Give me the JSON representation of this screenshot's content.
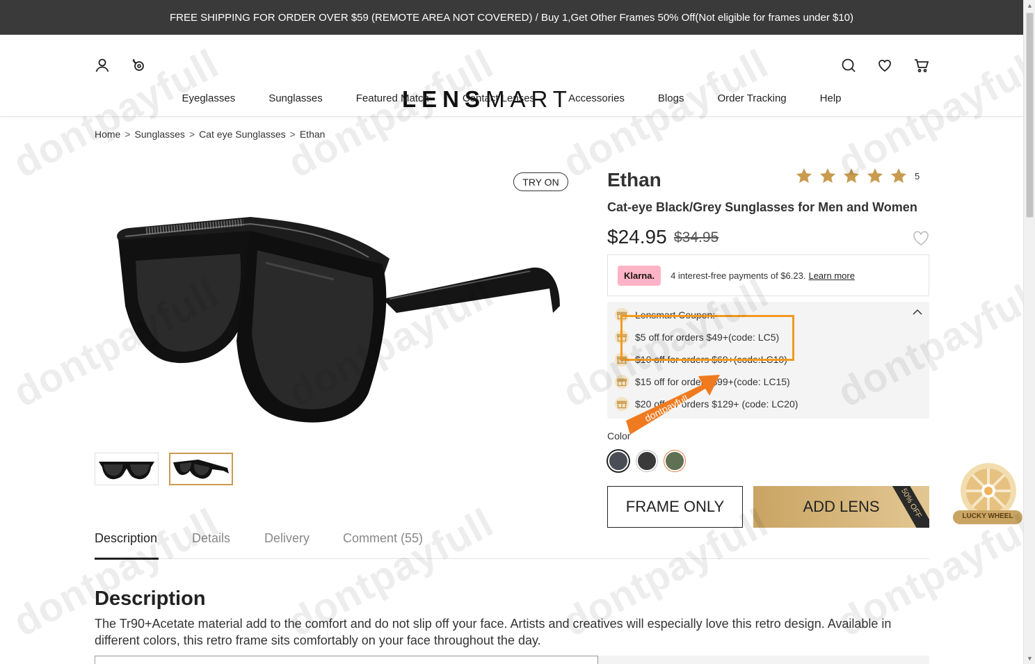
{
  "topbar": {
    "text": "FREE SHIPPING FOR ORDER OVER $59 (REMOTE AREA NOT COVERED) / Buy 1,Get Other Frames 50% Off(Not eligible for frames under $10)"
  },
  "header": {
    "logo_bold": "LENS",
    "logo_light": "MART",
    "icons": [
      "user-icon",
      "lens-icon",
      "search-icon",
      "heart-icon",
      "cart-icon"
    ]
  },
  "nav": [
    "Eyeglasses",
    "Sunglasses",
    "Featured Match",
    "Contact Lenses",
    "Accessories",
    "Blogs",
    "Order Tracking",
    "Help"
  ],
  "breadcrumb": {
    "items": [
      "Home",
      "Sunglasses",
      "Cat eye Sunglasses",
      "Ethan"
    ],
    "separator": ">"
  },
  "gallery": {
    "try_on": "TRY ON",
    "selected_thumb": 1
  },
  "product": {
    "name": "Ethan",
    "rating_count": "5",
    "subtitle": "Cat-eye Black/Grey Sunglasses for Men and Women",
    "price": "$24.95",
    "old_price": "$34.95",
    "rating_value": 5,
    "rating_max": 5,
    "star_color": "#c89b4f"
  },
  "klarna": {
    "badge": "Klarna.",
    "text": "4 interest-free payments of $6.23.",
    "link": "Learn more"
  },
  "coupons": {
    "title": "Lensmart Coupon:",
    "items": [
      "$5 off for orders $49+(code: LC5)",
      "$10 off for orders $69+(code:LC10)",
      "$15 off for orders $99+(code: LC15)",
      "$20 off for orders $129+ (code: LC20)"
    ]
  },
  "watermark": {
    "text": "dontpayfull",
    "arrow_label": "dontpayfull"
  },
  "color": {
    "label": "Color",
    "swatches": [
      "#4a4d55",
      "#3a3a3a",
      "#5f7054"
    ],
    "selected": 0
  },
  "buttons": {
    "frame_only": "FRAME ONLY",
    "add_lens": "ADD LENS",
    "ribbon": "50% OFF"
  },
  "lucky_wheel": {
    "label": "LUCKY WHEEL"
  },
  "tabs": [
    "Description",
    "Details",
    "Delivery",
    "Comment (55)"
  ],
  "description": {
    "heading": "Description",
    "text": "The Tr90+Acetate material add to the comfort and do not slip off your face. Artists and creatives will especially love this retro design. Available in different colors, this retro frame sits comfortably on your face throughout the day."
  },
  "colors": {
    "accent_gold": "#c89b4f",
    "highlight_orange": "#f39a1f",
    "topbar_bg": "#3a3a3a"
  }
}
